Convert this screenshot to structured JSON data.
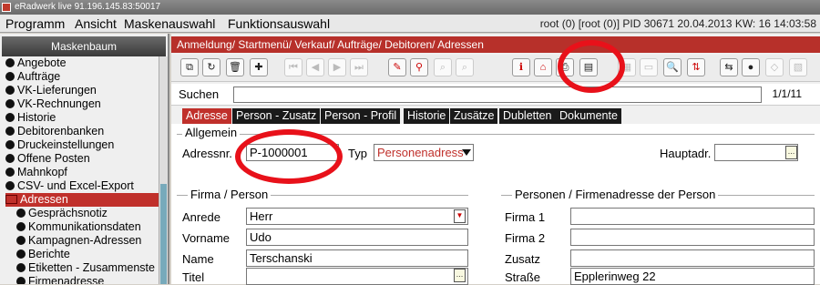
{
  "window": {
    "title": "eRadwerk live 91.196.145.83:50017"
  },
  "menu": {
    "items": [
      "Programm",
      "Ansicht",
      "Maskenauswahl",
      "Funktionsauswahl"
    ],
    "status": "root (0) [root (0)] PID 30671 20.04.2013 KW: 16 14:03:58"
  },
  "sidebar": {
    "title": "Maskenbaum",
    "items": [
      "Angebote",
      "Aufträge",
      "VK-Lieferungen",
      "VK-Rechnungen",
      "Historie",
      "Debitorenbanken",
      "Druckeinstellungen",
      "Offene Posten",
      "Mahnkopf",
      "CSV- und Excel-Export",
      "Adressen"
    ],
    "subitems": [
      "Gesprächsnotiz",
      "Kommunikationsdaten",
      "Kampagnen-Adressen",
      "Berichte",
      "Etiketten - Zusammenste",
      "Firmenadresse"
    ]
  },
  "breadcrumb": "Anmeldung/ Startmenü/ Verkauf/ Aufträge/ Debitoren/ Adressen",
  "search": {
    "label": "Suchen",
    "value": "",
    "pager": "1/1/11"
  },
  "tabs": [
    "Adresse",
    "Person - Zusatz",
    "Person - Profil",
    "Historie",
    "Zusätze",
    "Dubletten",
    "Dokumente"
  ],
  "allgemein": {
    "title": "Allgemein",
    "adressnr_label": "Adressnr.",
    "adressnr_value": "P-1000001",
    "typ_label": "Typ",
    "typ_value": "Personenadress",
    "hauptadr_label": "Hauptadr.",
    "hauptadr_value": ""
  },
  "firma_person": {
    "title": "Firma / Person",
    "fields": [
      {
        "label": "Anrede",
        "value": "Herr"
      },
      {
        "label": "Vorname",
        "value": "Udo"
      },
      {
        "label": "Name",
        "value": "Terschanski"
      },
      {
        "label": "Titel",
        "value": ""
      }
    ]
  },
  "personen_firmen": {
    "title": "Personen / Firmenadresse der Person",
    "fields": [
      {
        "label": "Firma 1",
        "value": ""
      },
      {
        "label": "Firma 2",
        "value": ""
      },
      {
        "label": "Zusatz",
        "value": ""
      },
      {
        "label": "Straße",
        "value": "Epplerinweg 22"
      }
    ]
  },
  "colors": {
    "accent": "#c0302b",
    "annotation": "#e8111a"
  }
}
